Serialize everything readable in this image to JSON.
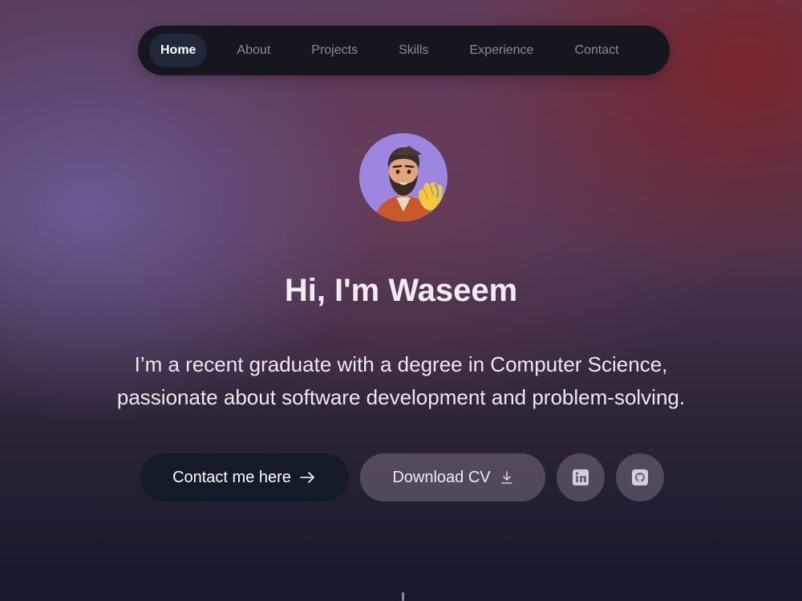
{
  "nav": {
    "items": [
      {
        "label": "Home",
        "active": true
      },
      {
        "label": "About"
      },
      {
        "label": "Projects"
      },
      {
        "label": "Skills"
      },
      {
        "label": "Experience"
      },
      {
        "label": "Contact"
      }
    ]
  },
  "hero": {
    "avatar_icon": "waving-man-avatar",
    "headline": "Hi, I'm Waseem",
    "intro_line1": "I’m a recent graduate with a degree in Computer Science,",
    "intro_line2": "passionate about software development and problem-solving."
  },
  "actions": {
    "contact_label": "Contact me here",
    "contact_icon": "arrow-right-icon",
    "cv_label": "Download CV",
    "cv_icon": "download-icon",
    "linkedin_icon": "linkedin-icon",
    "github_icon": "github-icon"
  },
  "colors": {
    "nav_bg": "#16161f",
    "nav_active": "#21283a",
    "primary_button": "#131a28",
    "avatar_bg": "#9d86e0"
  }
}
